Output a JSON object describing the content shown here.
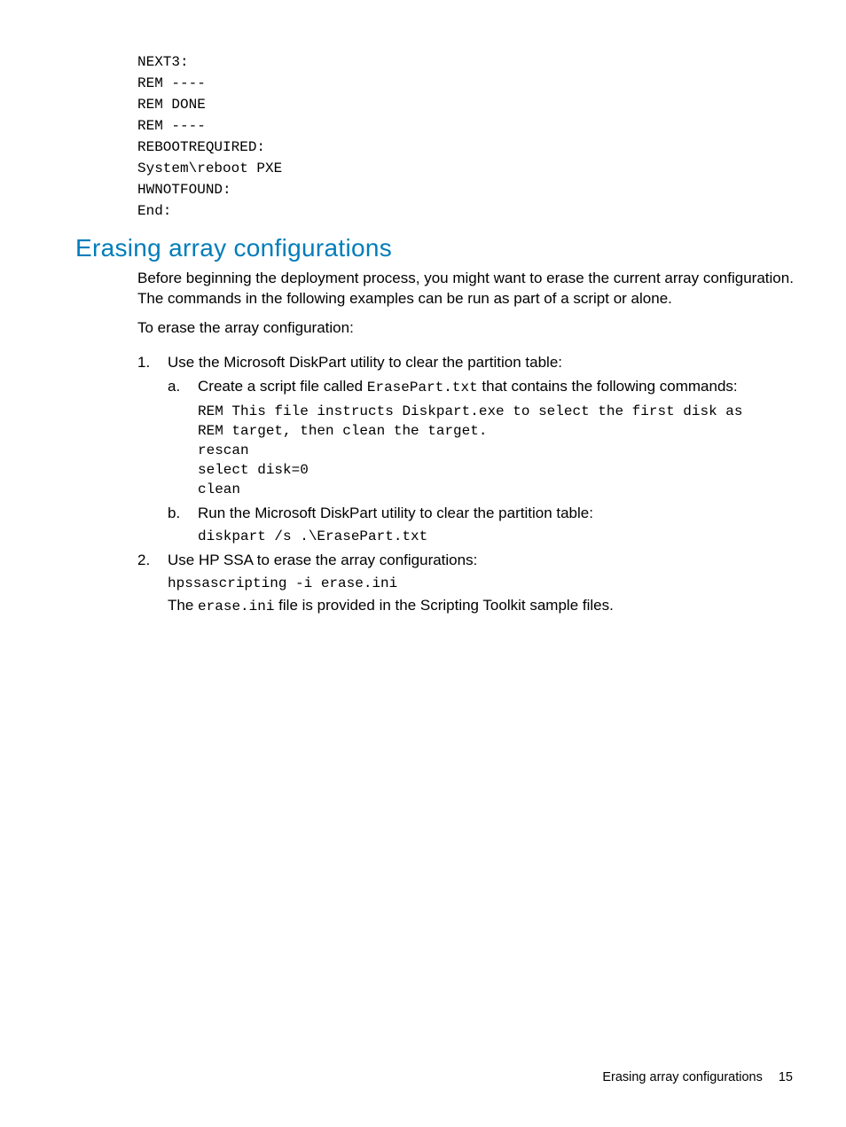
{
  "codeblock1": "NEXT3:\nREM ----\nREM DONE\nREM ----\nREBOOTREQUIRED:\nSystem\\reboot PXE\nHWNOTFOUND:\nEnd:",
  "heading": "Erasing array configurations",
  "intro": "Before beginning the deployment process, you might want to erase the current array configuration. The commands in the following examples can be run as part of a script or alone.",
  "lead": "To erase the array configuration:",
  "step1_text": "Use the Microsoft DiskPart utility to clear the partition table:",
  "step1a_prefix": "Create a script file called ",
  "step1a_code": "ErasePart.txt",
  "step1a_suffix": " that contains the following commands:",
  "step1a_block": "REM This file instructs Diskpart.exe to select the first disk as\nREM target, then clean the target.\nrescan\nselect disk=0\nclean",
  "step1b_text": "Run the Microsoft DiskPart utility to clear the partition table:",
  "step1b_block": "diskpart /s .\\ErasePart.txt",
  "step2_text": "Use HP SSA to erase the array configurations:",
  "step2_block": "hpssascripting -i erase.ini",
  "step2_tail_pre": "The ",
  "step2_tail_code": "erase.ini",
  "step2_tail_post": " file is provided in the Scripting Toolkit sample files.",
  "footer_label": "Erasing array configurations",
  "footer_page": "15",
  "markers": {
    "a": "a.",
    "b": "b."
  }
}
